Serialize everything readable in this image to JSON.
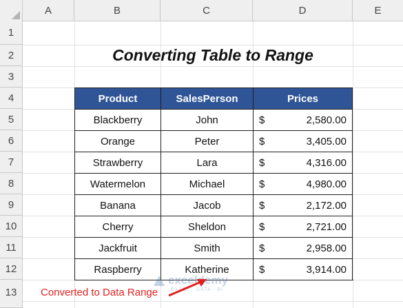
{
  "columns": [
    "A",
    "B",
    "C",
    "D",
    "E"
  ],
  "rows": [
    "1",
    "2",
    "3",
    "4",
    "5",
    "6",
    "7",
    "8",
    "9",
    "10",
    "11",
    "12",
    "13"
  ],
  "title": "Converting Table to Range",
  "table": {
    "headers": [
      "Product",
      "SalesPerson",
      "Prices"
    ],
    "currency": "$",
    "rows": [
      {
        "product": "Blackberry",
        "person": "John",
        "price": "2,580.00"
      },
      {
        "product": "Orange",
        "person": "Peter",
        "price": "3,405.00"
      },
      {
        "product": "Strawberry",
        "person": "Lara",
        "price": "4,316.00"
      },
      {
        "product": "Watermelon",
        "person": "Michael",
        "price": "4,980.00"
      },
      {
        "product": "Banana",
        "person": "Jacob",
        "price": "2,172.00"
      },
      {
        "product": "Cherry",
        "person": "Sheldon",
        "price": "2,721.00"
      },
      {
        "product": "Jackfruit",
        "person": "Smith",
        "price": "2,958.00"
      },
      {
        "product": "Raspberry",
        "person": "Katherine",
        "price": "3,914.00"
      }
    ]
  },
  "annotation": "Converted to Data Range",
  "watermark": {
    "brand": "exceldemy",
    "tagline": "EXCEL · DATA · BI"
  },
  "colors": {
    "header_fill": "#2f5597",
    "annotation": "#e02020"
  }
}
